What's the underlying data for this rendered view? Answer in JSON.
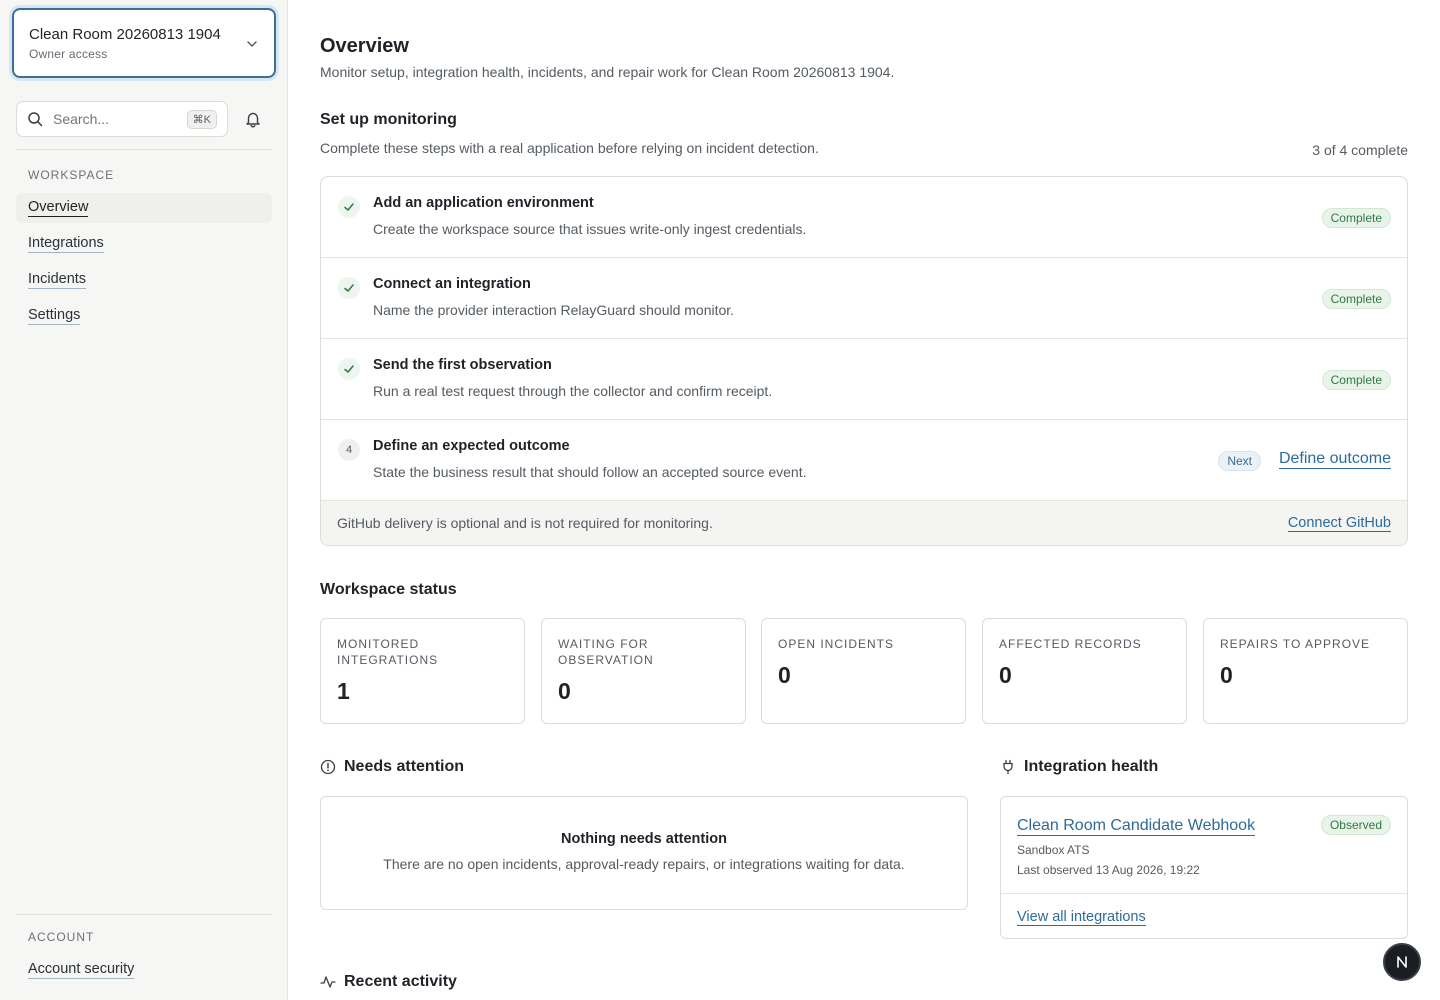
{
  "workspace": {
    "name": "Clean Room 20260813 1904",
    "access": "Owner access"
  },
  "search": {
    "placeholder": "Search...",
    "shortcut": "⌘K"
  },
  "sidebar": {
    "workspace_heading": "WORKSPACE",
    "items": [
      {
        "label": "Overview",
        "active": true
      },
      {
        "label": "Integrations"
      },
      {
        "label": "Incidents"
      },
      {
        "label": "Settings"
      }
    ],
    "account_heading": "ACCOUNT",
    "account_items": [
      {
        "label": "Account security"
      }
    ]
  },
  "page": {
    "title": "Overview",
    "subtitle": "Monitor setup, integration health, incidents, and repair work for Clean Room 20260813 1904."
  },
  "setup": {
    "title": "Set up monitoring",
    "subtitle": "Complete these steps with a real application before relying on incident detection.",
    "progress": "3 of 4 complete",
    "steps": [
      {
        "title": "Add an application environment",
        "description": "Create the workspace source that issues write-only ingest credentials.",
        "status": "Complete"
      },
      {
        "title": "Connect an integration",
        "description": "Name the provider interaction RelayGuard should monitor.",
        "status": "Complete"
      },
      {
        "title": "Send the first observation",
        "description": "Run a real test request through the collector and confirm receipt.",
        "status": "Complete"
      },
      {
        "number": "4",
        "title": "Define an expected outcome",
        "description": "State the business result that should follow an accepted source event.",
        "status": "Next",
        "action": "Define outcome"
      }
    ],
    "footer_text": "GitHub delivery is optional and is not required for monitoring.",
    "footer_action": "Connect GitHub"
  },
  "status": {
    "title": "Workspace status",
    "cards": [
      {
        "label": "MONITORED INTEGRATIONS",
        "value": "1"
      },
      {
        "label": "WAITING FOR OBSERVATION",
        "value": "0"
      },
      {
        "label": "OPEN INCIDENTS",
        "value": "0"
      },
      {
        "label": "AFFECTED RECORDS",
        "value": "0"
      },
      {
        "label": "REPAIRS TO APPROVE",
        "value": "0"
      }
    ]
  },
  "attention": {
    "title": "Needs attention",
    "empty_title": "Nothing needs attention",
    "empty_desc": "There are no open incidents, approval-ready repairs, or integrations waiting for data."
  },
  "health": {
    "title": "Integration health",
    "integration": {
      "name": "Clean Room Candidate Webhook",
      "status": "Observed",
      "source": "Sandbox ATS",
      "last_observed": "Last observed 13 Aug 2026, 19:22"
    },
    "view_all": "View all integrations"
  },
  "activity": {
    "title": "Recent activity"
  },
  "fab": {
    "letter": "N"
  },
  "colors": {
    "accent": "#2d6b9a",
    "success": "#2f7a44",
    "focus_ring": "#3d6e9a"
  }
}
